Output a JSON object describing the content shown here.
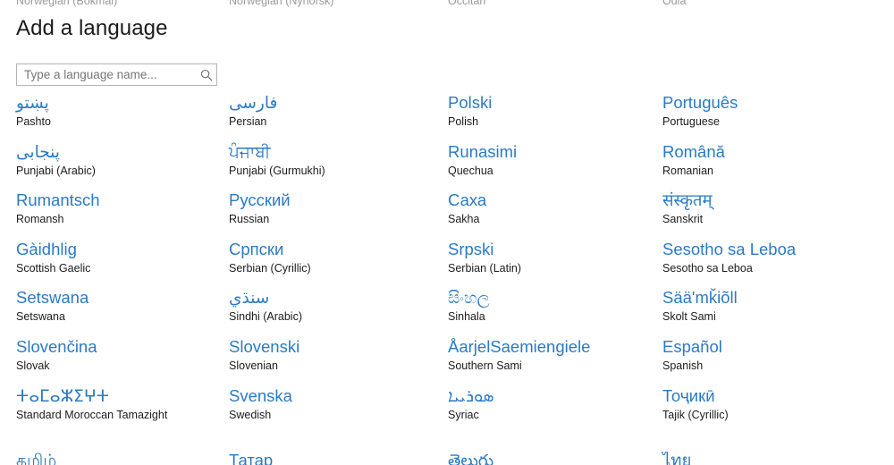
{
  "window": {
    "title": "Add a language"
  },
  "colors": {
    "accent_blue": "#2a7ac4",
    "text_primary": "#1c1c1c",
    "placeholder": "#767676",
    "field_border": "#b4b4b4",
    "background": "#ffffff"
  },
  "search": {
    "placeholder": "Type a language name...",
    "value": "",
    "icon": "search-icon"
  },
  "partial_row_top": [
    "Norwegian (Bokmål)",
    "Norwegian (Nynorsk)",
    "Occitan",
    "Odia"
  ],
  "partial_row_bottom": [
    "தமிழ்",
    "Татар",
    "తెలుగు",
    "ไทย"
  ],
  "columns": [
    {
      "items": [
        {
          "native": "پښتو",
          "english": "Pashto"
        },
        {
          "native": "پنجابی",
          "english": "Punjabi (Arabic)"
        },
        {
          "native": "Rumantsch",
          "english": "Romansh"
        },
        {
          "native": "Gàidhlig",
          "english": "Scottish Gaelic"
        },
        {
          "native": "Setswana",
          "english": "Setswana"
        },
        {
          "native": "Slovenčina",
          "english": "Slovak"
        },
        {
          "native": "ⵜⴰⵎⴰⵣⵉⵖⵜ",
          "english": "Standard Moroccan Tamazight"
        }
      ]
    },
    {
      "items": [
        {
          "native": "فارسی",
          "english": "Persian"
        },
        {
          "native": "ਪੰਜਾਬੀ",
          "english": "Punjabi (Gurmukhi)"
        },
        {
          "native": "Русский",
          "english": "Russian"
        },
        {
          "native": "Српски",
          "english": "Serbian (Cyrillic)"
        },
        {
          "native": "سنڌي",
          "english": "Sindhi (Arabic)"
        },
        {
          "native": "Slovenski",
          "english": "Slovenian"
        },
        {
          "native": "Svenska",
          "english": "Swedish"
        }
      ]
    },
    {
      "items": [
        {
          "native": "Polski",
          "english": "Polish"
        },
        {
          "native": "Runasimi",
          "english": "Quechua"
        },
        {
          "native": "Саха",
          "english": "Sakha"
        },
        {
          "native": "Srpski",
          "english": "Serbian (Latin)"
        },
        {
          "native": "සිංහල",
          "english": "Sinhala"
        },
        {
          "native": "ÅarjelSaemiengiele",
          "english": "Southern Sami"
        },
        {
          "native": "ܣܘܪܝܝܐ",
          "english": "Syriac"
        }
      ]
    },
    {
      "items": [
        {
          "native": "Português",
          "english": "Portuguese"
        },
        {
          "native": "Română",
          "english": "Romanian"
        },
        {
          "native": "संस्कृतम्",
          "english": "Sanskrit"
        },
        {
          "native": "Sesotho sa Leboa",
          "english": "Sesotho sa Leboa"
        },
        {
          "native": "Sääʹmǩiõll",
          "english": "Skolt Sami"
        },
        {
          "native": "Español",
          "english": "Spanish"
        },
        {
          "native": "Тоҷикӣ",
          "english": "Tajik (Cyrillic)"
        }
      ]
    }
  ]
}
